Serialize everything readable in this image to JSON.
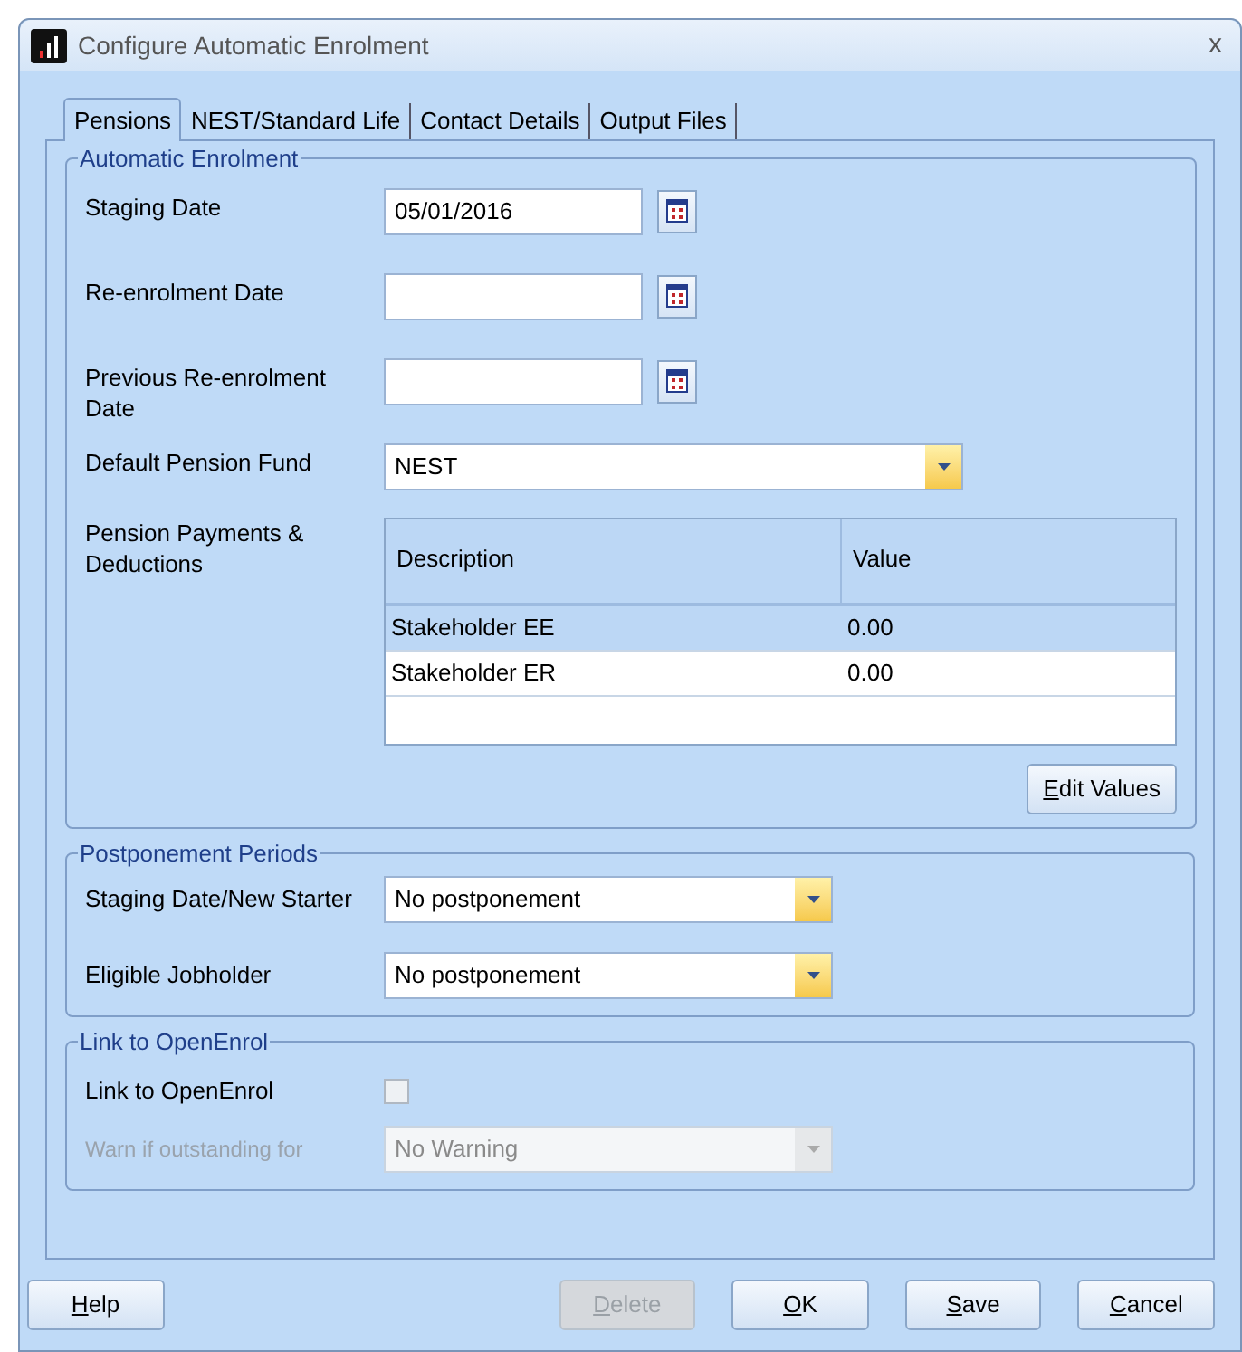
{
  "window": {
    "title": "Configure Automatic Enrolment",
    "close": "x"
  },
  "tabs": [
    {
      "label": "Pensions",
      "selected": true
    },
    {
      "label": "NEST/Standard Life",
      "selected": false
    },
    {
      "label": "Contact Details",
      "selected": false
    },
    {
      "label": "Output Files",
      "selected": false
    }
  ],
  "automatic_enrolment": {
    "title": "Automatic Enrolment",
    "fields": [
      {
        "kind": "date",
        "label": "Staging Date",
        "value": "05/01/2016"
      },
      {
        "kind": "date",
        "label": "Re-enrolment Date"
      },
      {
        "kind": "date",
        "label": "Previous Re-enrolment Date"
      },
      {
        "kind": "combo",
        "label": "Default Pension Fund",
        "value": "NEST"
      }
    ],
    "payments": {
      "label": "Pension Payments & Deductions",
      "columns": [
        "Description",
        "Value"
      ],
      "rows": [
        {
          "cells": [
            "Stakeholder EE",
            "0.00"
          ],
          "selected": true
        },
        {
          "cells": [
            "Stakeholder ER",
            "0.00"
          ],
          "selected": false
        }
      ],
      "button": "Edit Values"
    }
  },
  "postponement_periods": {
    "title": "Postponement Periods",
    "fields": [
      {
        "label": "Staging Date/New Starter",
        "value": "No postponement"
      },
      {
        "label": "Eligible Jobholder",
        "value": "No postponement"
      }
    ]
  },
  "link_to_openenrol": {
    "title": "Link to OpenEnrol",
    "checkbox": {
      "label": "Link to OpenEnrol",
      "checked": false
    },
    "warn": {
      "label": "Warn if outstanding for",
      "value": "No Warning",
      "disabled": true
    }
  },
  "buttons": [
    {
      "label": "Help",
      "disabled": false
    },
    {
      "label": "Delete",
      "disabled": true
    },
    {
      "label": "OK",
      "disabled": false
    },
    {
      "label": "Save",
      "disabled": false
    },
    {
      "label": "Cancel",
      "disabled": false
    }
  ]
}
